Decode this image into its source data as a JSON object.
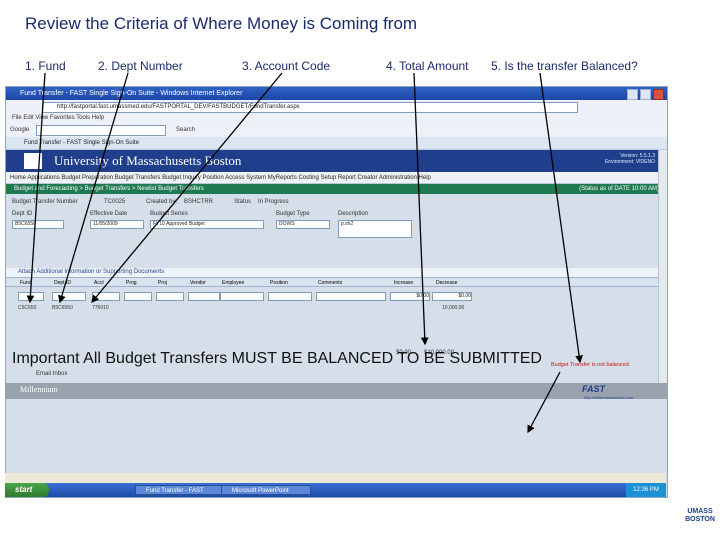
{
  "slide": {
    "title": "Review the Criteria of Where Money is Coming from",
    "steps": [
      "1. Fund",
      "2. Dept Number",
      "3. Account Code",
      "4. Total Amount",
      "5. Is the transfer Balanced?"
    ],
    "important": "Important All Budget Transfers MUST BE BALANCED TO BE SUBMITTED"
  },
  "browser": {
    "title": "Fund Transfer - FAST Single Sign-On Suite - Windows Internet Explorer",
    "url": "http://fastportal.fast.umassmed.edu/FASTPORTAL_DEV/FASTBUDGET/FundTransfer.aspx",
    "menu": "File   Edit   View   Favorites   Tools   Help",
    "google_label": "Google",
    "google_search": "Search",
    "tab_label": "Fund Transfer - FAST Single Sign-On Suite"
  },
  "app": {
    "university": "University of Massachusetts Boston",
    "user_info": [
      "Version: 5.5.1.3",
      "Environment: VIDENO"
    ],
    "nav": "Home   Applications   Budget Preparation   Budget Transfers   Budget Inquiry   Position   Access System   MyReports   Costing   Setup   Report Creator   Administration   Help",
    "breadcrumb": "Budget and Forecasting > Budget Transfers > Newlist Budget Transfers",
    "breadcrumb_right": "(Status as of DATE 10:00 AM)",
    "transfer_number_label": "Budget Transfer Number",
    "transfer_number": "TC0025",
    "created_by_label": "Created by:",
    "created_by": "BSHCTRR",
    "status_label": "Status",
    "status": "In Progress",
    "labels": {
      "dept": "Dept ID",
      "effective_date": "Effective Date",
      "budget_series": "Budget Series",
      "budget_type": "Budget Type",
      "description": "Description"
    },
    "values": {
      "dept": "B5C6550",
      "effective_date": "11/05/2009",
      "budget_series": "FY10 Approved Budget",
      "budget_type": "DOWS",
      "description": "p.sh2"
    },
    "attach_link": "Attach Additional Information or Supporting Documents",
    "table_headers": [
      "Fund",
      "Dept ID",
      "Acct",
      "Prog",
      "Proj",
      "Vendor",
      "Employee",
      "Position",
      "Comments",
      "Increase",
      "Decrease"
    ],
    "row_values": [
      "",
      "",
      "",
      "",
      "",
      "",
      "",
      "",
      "",
      "$0.00",
      "$0.00"
    ],
    "line_fund": "C5C650",
    "line_dept": "B5C6550",
    "line_acct": "776010",
    "line_decrease": "10,000.00",
    "total_increase": "$0.00",
    "total_decrease": "$10,000.00",
    "warning": "Budget Transfer is not balanced.",
    "email_label": "Email Inbox",
    "millennium": "Millennium",
    "fast_brand": "FAST",
    "fast_url": "http://millenniumschool.com"
  },
  "taskbar": {
    "start": "start",
    "tasks": [
      "Fund Transfer - FAST",
      "Microsoft PowerPoint"
    ],
    "clock": "12:36 PM"
  },
  "brand": {
    "line1": "UMASS",
    "line2": "BOSTON"
  }
}
